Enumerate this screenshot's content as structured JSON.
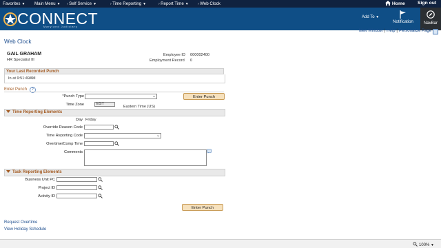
{
  "topbar": {
    "crumbs": [
      "Favorites",
      "Main Menu",
      "Self Service",
      "Time Reporting",
      "Report Time",
      "Web Clock"
    ],
    "home_label": "Home",
    "signout_label": "Sign out"
  },
  "header": {
    "logo_text": "CONNECT",
    "logo_sub": "Maryland Judiciary",
    "add_to_label": "Add To",
    "notification_label": "Notification",
    "navbar_label": "NavBar"
  },
  "links": {
    "new_window": "New Window",
    "help": "Help",
    "personalize": "Personalize Page"
  },
  "page": {
    "title": "Web Clock",
    "employee_name": "GAIL GRAHAM",
    "employee_title": "HR Specialist III",
    "employee_id_label": "Employee ID",
    "employee_id_value": "000002400",
    "employment_record_label": "Employment Record",
    "employment_record_value": "0"
  },
  "last_punch": {
    "header": "Your Last Recorded Punch",
    "text": "In at  9:51:49AM"
  },
  "enter_punch": {
    "header": "Enter Punch",
    "help_icon": "?",
    "punch_type_label": "*Punch Type",
    "time_zone_label": "Time Zone",
    "time_zone_value": "EST",
    "time_zone_desc": "Eastern Time (US)",
    "button": "Enter Punch"
  },
  "time_reporting": {
    "header": "Time Reporting Elements",
    "day_label": "Day",
    "day_value": "Friday",
    "override_label": "Override Reason Code",
    "trc_label": "Time Reporting Code",
    "overtime_label": "Overtime/Comp Time",
    "comments_label": "Comments"
  },
  "task_reporting": {
    "header": "Task Reporting Elements",
    "business_unit_label": "Business Unit PC",
    "project_label": "Project ID",
    "activity_label": "Activity ID",
    "button": "Enter Punch"
  },
  "footer_links": {
    "request_overtime": "Request Overtime",
    "holiday_schedule": "View Holiday Schedule"
  },
  "statusbar": {
    "zoom": "100%"
  },
  "colors": {
    "topbar_bg": "#10223f",
    "header_bg": "#0f4e86",
    "section_title": "#a35a21",
    "link": "#1f4f8f",
    "button_bg": "#f6e1bd"
  }
}
